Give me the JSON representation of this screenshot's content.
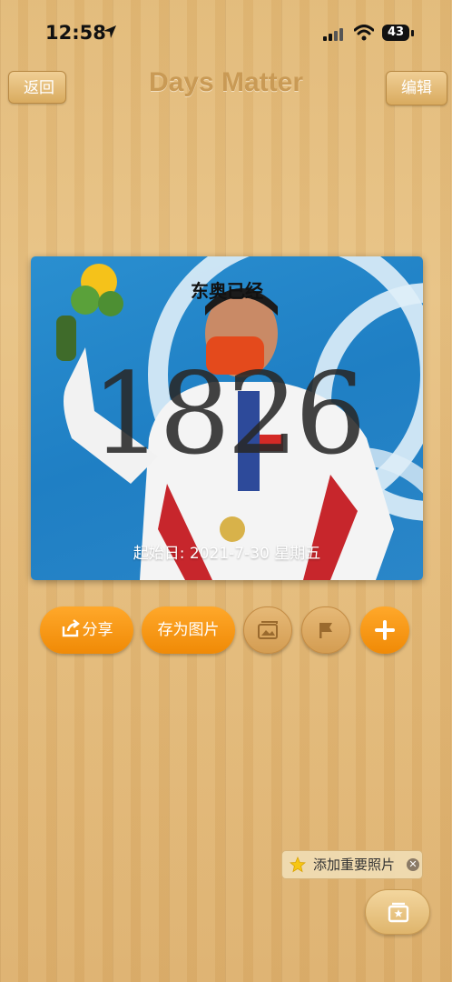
{
  "status_bar": {
    "time": "12:58",
    "battery": "43"
  },
  "nav": {
    "back_label": "返回",
    "title": "Days Matter",
    "edit_label": "编辑"
  },
  "card": {
    "title": "东奥已经",
    "count": "1826",
    "start_date": "起始日: 2021-7-30 星期五"
  },
  "actions": {
    "share_label": "分享",
    "save_label": "存为图片",
    "icons": [
      "share-icon",
      "photo-icon",
      "flag-icon",
      "plus-icon"
    ]
  },
  "tip": {
    "text": "添加重要照片",
    "icon": "star-icon"
  },
  "colors": {
    "accent": "#f59a12",
    "wood": "#e4ba78",
    "nav_title": "#c99a55"
  }
}
